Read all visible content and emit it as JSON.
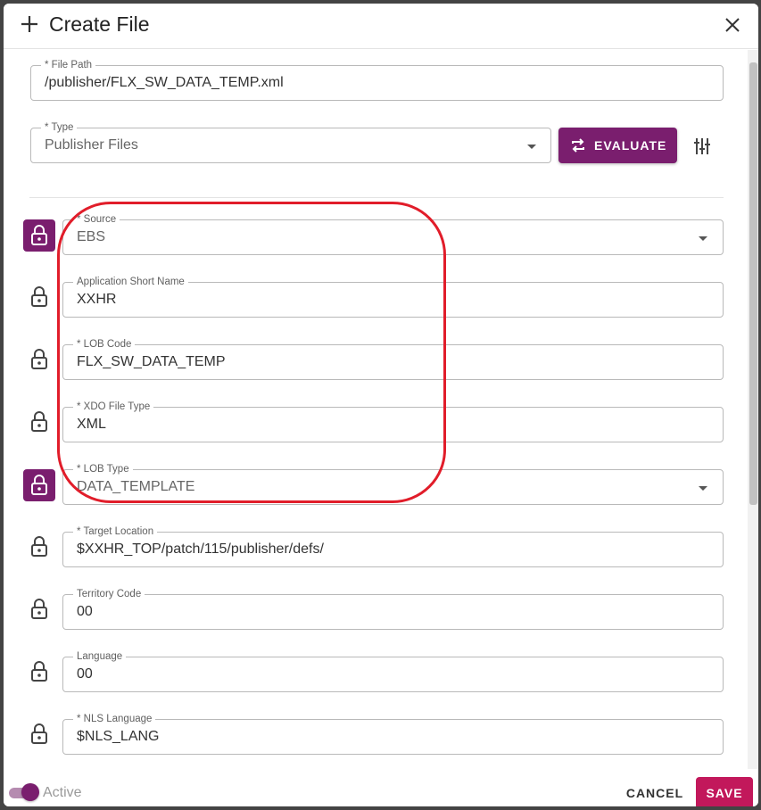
{
  "dialog": {
    "title": "Create File",
    "icons": {
      "title": "plus-icon",
      "close": "close-icon"
    }
  },
  "top_fields": {
    "file_path": {
      "label": "* File Path",
      "value": "/publisher/FLX_SW_DATA_TEMP.xml"
    },
    "type": {
      "label": "* Type",
      "value": "Publisher Files"
    }
  },
  "evaluate_button": {
    "label": "EVALUATE",
    "icon": "swap-arrows-icon"
  },
  "locked_fields": [
    {
      "label": "* Source",
      "value": "EBS",
      "locked": true,
      "dropdown": true
    },
    {
      "label": "Application Short Name",
      "value": "XXHR",
      "locked": false,
      "dropdown": false
    },
    {
      "label": "* LOB Code",
      "value": "FLX_SW_DATA_TEMP",
      "locked": false,
      "dropdown": false
    },
    {
      "label": "* XDO File Type",
      "value": "XML",
      "locked": false,
      "dropdown": false
    },
    {
      "label": "* LOB Type",
      "value": "DATA_TEMPLATE",
      "locked": true,
      "dropdown": true
    },
    {
      "label": "* Target Location",
      "value": "$XXHR_TOP/patch/115/publisher/defs/",
      "locked": false,
      "dropdown": false
    },
    {
      "label": "Territory Code",
      "value": "00",
      "locked": false,
      "dropdown": false
    },
    {
      "label": "Language",
      "value": "00",
      "locked": false,
      "dropdown": false
    },
    {
      "label": "* NLS Language",
      "value": "$NLS_LANG",
      "locked": false,
      "dropdown": false
    }
  ],
  "footer": {
    "active_label": "Active",
    "active_on": true,
    "cancel_label": "CANCEL",
    "save_label": "SAVE"
  },
  "colors": {
    "accent": "#7a1e6e",
    "save": "#c2185b",
    "highlight": "#e11d2a"
  }
}
